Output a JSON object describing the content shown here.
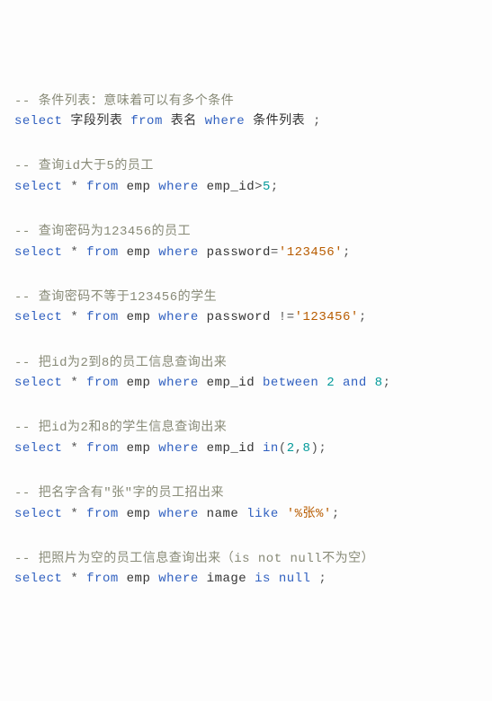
{
  "lines": [
    {
      "tokens": [
        {
          "t": "-- 条件列表：意味着可以有多个条件",
          "c": "comment"
        }
      ]
    },
    {
      "tokens": [
        {
          "t": "select",
          "c": "kw"
        },
        {
          "t": " 字段列表 ",
          "c": "ident"
        },
        {
          "t": "from",
          "c": "kw"
        },
        {
          "t": " 表名 ",
          "c": "ident"
        },
        {
          "t": "where",
          "c": "kw"
        },
        {
          "t": " 条件列表 ",
          "c": "ident"
        },
        {
          "t": ";",
          "c": "punct"
        }
      ]
    },
    {
      "blank": true
    },
    {
      "blank": true
    },
    {
      "tokens": [
        {
          "t": "-- 查询id大于5的员工",
          "c": "comment"
        }
      ]
    },
    {
      "tokens": [
        {
          "t": "select",
          "c": "kw"
        },
        {
          "t": " ",
          "c": "ident"
        },
        {
          "t": "*",
          "c": "op"
        },
        {
          "t": " ",
          "c": "ident"
        },
        {
          "t": "from",
          "c": "kw"
        },
        {
          "t": " emp ",
          "c": "ident"
        },
        {
          "t": "where",
          "c": "kw"
        },
        {
          "t": " emp_id",
          "c": "ident"
        },
        {
          "t": ">",
          "c": "op"
        },
        {
          "t": "5",
          "c": "num"
        },
        {
          "t": ";",
          "c": "punct"
        }
      ]
    },
    {
      "blank": true
    },
    {
      "blank": true
    },
    {
      "tokens": [
        {
          "t": "-- 查询密码为123456的员工",
          "c": "comment"
        }
      ]
    },
    {
      "tokens": [
        {
          "t": "select",
          "c": "kw"
        },
        {
          "t": " ",
          "c": "ident"
        },
        {
          "t": "*",
          "c": "op"
        },
        {
          "t": " ",
          "c": "ident"
        },
        {
          "t": "from",
          "c": "kw"
        },
        {
          "t": " emp ",
          "c": "ident"
        },
        {
          "t": "where",
          "c": "kw"
        },
        {
          "t": " password",
          "c": "ident"
        },
        {
          "t": "=",
          "c": "op"
        },
        {
          "t": "'123456'",
          "c": "str"
        },
        {
          "t": ";",
          "c": "punct"
        }
      ]
    },
    {
      "blank": true
    },
    {
      "blank": true
    },
    {
      "tokens": [
        {
          "t": "-- 查询密码不等于123456的学生",
          "c": "comment"
        }
      ]
    },
    {
      "tokens": [
        {
          "t": "select",
          "c": "kw"
        },
        {
          "t": " ",
          "c": "ident"
        },
        {
          "t": "*",
          "c": "op"
        },
        {
          "t": " ",
          "c": "ident"
        },
        {
          "t": "from",
          "c": "kw"
        },
        {
          "t": " emp ",
          "c": "ident"
        },
        {
          "t": "where",
          "c": "kw"
        },
        {
          "t": " password ",
          "c": "ident"
        },
        {
          "t": "!=",
          "c": "op"
        },
        {
          "t": "'123456'",
          "c": "str"
        },
        {
          "t": ";",
          "c": "punct"
        }
      ]
    },
    {
      "blank": true
    },
    {
      "blank": true
    },
    {
      "tokens": [
        {
          "t": "-- 把id为2到8的员工信息查询出来",
          "c": "comment"
        }
      ]
    },
    {
      "tokens": [
        {
          "t": "select",
          "c": "kw"
        },
        {
          "t": " ",
          "c": "ident"
        },
        {
          "t": "*",
          "c": "op"
        },
        {
          "t": " ",
          "c": "ident"
        },
        {
          "t": "from",
          "c": "kw"
        },
        {
          "t": " emp ",
          "c": "ident"
        },
        {
          "t": "where",
          "c": "kw"
        },
        {
          "t": " emp_id ",
          "c": "ident"
        },
        {
          "t": "between",
          "c": "kw"
        },
        {
          "t": " ",
          "c": "ident"
        },
        {
          "t": "2",
          "c": "num"
        },
        {
          "t": " ",
          "c": "ident"
        },
        {
          "t": "and",
          "c": "kw"
        },
        {
          "t": " ",
          "c": "ident"
        },
        {
          "t": "8",
          "c": "num"
        },
        {
          "t": ";",
          "c": "punct"
        }
      ]
    },
    {
      "blank": true
    },
    {
      "blank": true
    },
    {
      "tokens": [
        {
          "t": "-- 把id为2和8的学生信息查询出来",
          "c": "comment"
        }
      ]
    },
    {
      "tokens": [
        {
          "t": "select",
          "c": "kw"
        },
        {
          "t": " ",
          "c": "ident"
        },
        {
          "t": "*",
          "c": "op"
        },
        {
          "t": " ",
          "c": "ident"
        },
        {
          "t": "from",
          "c": "kw"
        },
        {
          "t": " emp ",
          "c": "ident"
        },
        {
          "t": "where",
          "c": "kw"
        },
        {
          "t": " emp_id ",
          "c": "ident"
        },
        {
          "t": "in",
          "c": "kw"
        },
        {
          "t": "(",
          "c": "punct"
        },
        {
          "t": "2",
          "c": "num"
        },
        {
          "t": ",",
          "c": "punct"
        },
        {
          "t": "8",
          "c": "num"
        },
        {
          "t": ")",
          "c": "punct"
        },
        {
          "t": ";",
          "c": "punct"
        }
      ]
    },
    {
      "blank": true
    },
    {
      "blank": true
    },
    {
      "tokens": [
        {
          "t": "-- 把名字含有\"张\"字的员工招出来",
          "c": "comment"
        }
      ]
    },
    {
      "tokens": [
        {
          "t": "select",
          "c": "kw"
        },
        {
          "t": " ",
          "c": "ident"
        },
        {
          "t": "*",
          "c": "op"
        },
        {
          "t": " ",
          "c": "ident"
        },
        {
          "t": "from",
          "c": "kw"
        },
        {
          "t": " emp ",
          "c": "ident"
        },
        {
          "t": "where",
          "c": "kw"
        },
        {
          "t": " name ",
          "c": "ident"
        },
        {
          "t": "like",
          "c": "kw"
        },
        {
          "t": " ",
          "c": "ident"
        },
        {
          "t": "'%张%'",
          "c": "str"
        },
        {
          "t": ";",
          "c": "punct"
        }
      ]
    },
    {
      "blank": true
    },
    {
      "blank": true
    },
    {
      "tokens": [
        {
          "t": "-- 把照片为空的员工信息查询出来（is not null不为空）",
          "c": "comment"
        }
      ]
    },
    {
      "tokens": [
        {
          "t": "select",
          "c": "kw"
        },
        {
          "t": " ",
          "c": "ident"
        },
        {
          "t": "*",
          "c": "op"
        },
        {
          "t": " ",
          "c": "ident"
        },
        {
          "t": "from",
          "c": "kw"
        },
        {
          "t": " emp ",
          "c": "ident"
        },
        {
          "t": "where",
          "c": "kw"
        },
        {
          "t": " image ",
          "c": "ident"
        },
        {
          "t": "is",
          "c": "kw"
        },
        {
          "t": " ",
          "c": "ident"
        },
        {
          "t": "null",
          "c": "kw"
        },
        {
          "t": " ",
          "c": "ident"
        },
        {
          "t": ";",
          "c": "punct"
        }
      ]
    }
  ]
}
